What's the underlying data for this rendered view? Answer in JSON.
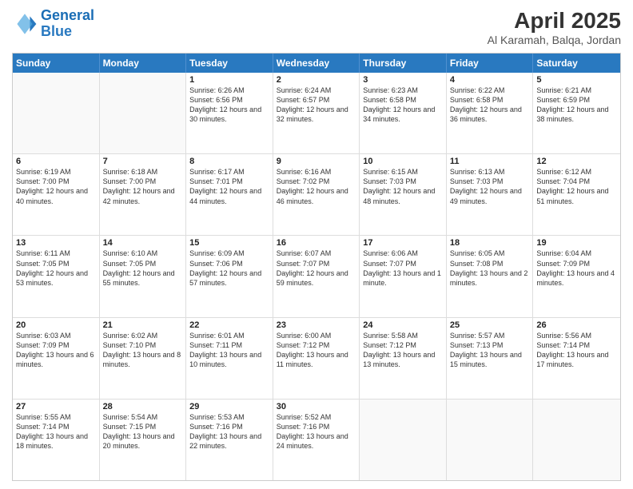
{
  "header": {
    "logo_text_general": "General",
    "logo_text_blue": "Blue",
    "month": "April 2025",
    "location": "Al Karamah, Balqa, Jordan"
  },
  "weekdays": [
    "Sunday",
    "Monday",
    "Tuesday",
    "Wednesday",
    "Thursday",
    "Friday",
    "Saturday"
  ],
  "rows": [
    [
      {
        "day": "",
        "empty": true
      },
      {
        "day": "",
        "empty": true
      },
      {
        "day": "1",
        "sunrise": "6:26 AM",
        "sunset": "6:56 PM",
        "daylight": "12 hours and 30 minutes."
      },
      {
        "day": "2",
        "sunrise": "6:24 AM",
        "sunset": "6:57 PM",
        "daylight": "12 hours and 32 minutes."
      },
      {
        "day": "3",
        "sunrise": "6:23 AM",
        "sunset": "6:58 PM",
        "daylight": "12 hours and 34 minutes."
      },
      {
        "day": "4",
        "sunrise": "6:22 AM",
        "sunset": "6:58 PM",
        "daylight": "12 hours and 36 minutes."
      },
      {
        "day": "5",
        "sunrise": "6:21 AM",
        "sunset": "6:59 PM",
        "daylight": "12 hours and 38 minutes."
      }
    ],
    [
      {
        "day": "6",
        "sunrise": "6:19 AM",
        "sunset": "7:00 PM",
        "daylight": "12 hours and 40 minutes."
      },
      {
        "day": "7",
        "sunrise": "6:18 AM",
        "sunset": "7:00 PM",
        "daylight": "12 hours and 42 minutes."
      },
      {
        "day": "8",
        "sunrise": "6:17 AM",
        "sunset": "7:01 PM",
        "daylight": "12 hours and 44 minutes."
      },
      {
        "day": "9",
        "sunrise": "6:16 AM",
        "sunset": "7:02 PM",
        "daylight": "12 hours and 46 minutes."
      },
      {
        "day": "10",
        "sunrise": "6:15 AM",
        "sunset": "7:03 PM",
        "daylight": "12 hours and 48 minutes."
      },
      {
        "day": "11",
        "sunrise": "6:13 AM",
        "sunset": "7:03 PM",
        "daylight": "12 hours and 49 minutes."
      },
      {
        "day": "12",
        "sunrise": "6:12 AM",
        "sunset": "7:04 PM",
        "daylight": "12 hours and 51 minutes."
      }
    ],
    [
      {
        "day": "13",
        "sunrise": "6:11 AM",
        "sunset": "7:05 PM",
        "daylight": "12 hours and 53 minutes."
      },
      {
        "day": "14",
        "sunrise": "6:10 AM",
        "sunset": "7:05 PM",
        "daylight": "12 hours and 55 minutes."
      },
      {
        "day": "15",
        "sunrise": "6:09 AM",
        "sunset": "7:06 PM",
        "daylight": "12 hours and 57 minutes."
      },
      {
        "day": "16",
        "sunrise": "6:07 AM",
        "sunset": "7:07 PM",
        "daylight": "12 hours and 59 minutes."
      },
      {
        "day": "17",
        "sunrise": "6:06 AM",
        "sunset": "7:07 PM",
        "daylight": "13 hours and 1 minute."
      },
      {
        "day": "18",
        "sunrise": "6:05 AM",
        "sunset": "7:08 PM",
        "daylight": "13 hours and 2 minutes."
      },
      {
        "day": "19",
        "sunrise": "6:04 AM",
        "sunset": "7:09 PM",
        "daylight": "13 hours and 4 minutes."
      }
    ],
    [
      {
        "day": "20",
        "sunrise": "6:03 AM",
        "sunset": "7:09 PM",
        "daylight": "13 hours and 6 minutes."
      },
      {
        "day": "21",
        "sunrise": "6:02 AM",
        "sunset": "7:10 PM",
        "daylight": "13 hours and 8 minutes."
      },
      {
        "day": "22",
        "sunrise": "6:01 AM",
        "sunset": "7:11 PM",
        "daylight": "13 hours and 10 minutes."
      },
      {
        "day": "23",
        "sunrise": "6:00 AM",
        "sunset": "7:12 PM",
        "daylight": "13 hours and 11 minutes."
      },
      {
        "day": "24",
        "sunrise": "5:58 AM",
        "sunset": "7:12 PM",
        "daylight": "13 hours and 13 minutes."
      },
      {
        "day": "25",
        "sunrise": "5:57 AM",
        "sunset": "7:13 PM",
        "daylight": "13 hours and 15 minutes."
      },
      {
        "day": "26",
        "sunrise": "5:56 AM",
        "sunset": "7:14 PM",
        "daylight": "13 hours and 17 minutes."
      }
    ],
    [
      {
        "day": "27",
        "sunrise": "5:55 AM",
        "sunset": "7:14 PM",
        "daylight": "13 hours and 18 minutes."
      },
      {
        "day": "28",
        "sunrise": "5:54 AM",
        "sunset": "7:15 PM",
        "daylight": "13 hours and 20 minutes."
      },
      {
        "day": "29",
        "sunrise": "5:53 AM",
        "sunset": "7:16 PM",
        "daylight": "13 hours and 22 minutes."
      },
      {
        "day": "30",
        "sunrise": "5:52 AM",
        "sunset": "7:16 PM",
        "daylight": "13 hours and 24 minutes."
      },
      {
        "day": "",
        "empty": true
      },
      {
        "day": "",
        "empty": true
      },
      {
        "day": "",
        "empty": true
      }
    ]
  ]
}
